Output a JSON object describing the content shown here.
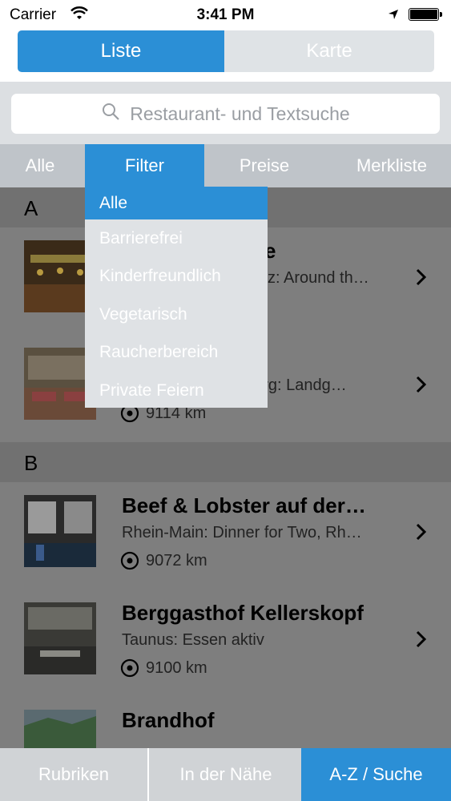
{
  "status_bar": {
    "carrier": "Carrier",
    "time": "3:41 PM"
  },
  "segment": {
    "list_label": "Liste",
    "map_label": "Karte"
  },
  "search": {
    "placeholder": "Restaurant- und Textsuche"
  },
  "filter_tabs": [
    {
      "label": "Alle"
    },
    {
      "label": "Filter"
    },
    {
      "label": "Preise"
    },
    {
      "label": "Merkliste"
    }
  ],
  "filter_dropdown": {
    "items": [
      {
        "label": "Alle"
      },
      {
        "label": "Barrierefrei"
      },
      {
        "label": "Kinderfreundlich"
      },
      {
        "label": "Vegetarisch"
      },
      {
        "label": "Raucherbereich"
      },
      {
        "label": "Private Feiern"
      }
    ]
  },
  "sections": [
    {
      "letter": "A",
      "rows": [
        {
          "title": "e",
          "subtitle": "z: Around th…",
          "distance": ""
        },
        {
          "title": "",
          "subtitle": "berg: Landg…",
          "distance": "9114 km"
        }
      ]
    },
    {
      "letter": "B",
      "rows": [
        {
          "title": "Beef & Lobster auf der…",
          "subtitle": "Rhein-Main: Dinner for Two, Rh…",
          "distance": "9072 km"
        },
        {
          "title": "Berggasthof Kellerskopf",
          "subtitle": "Taunus: Essen aktiv",
          "distance": "9100 km"
        },
        {
          "title": "Brandhof",
          "subtitle": "",
          "distance": ""
        }
      ]
    }
  ],
  "bottom_tabs": [
    {
      "label": "Rubriken"
    },
    {
      "label": "In der Nähe"
    },
    {
      "label": "A-Z / Suche"
    }
  ],
  "colors": {
    "accent": "#2b8fd6",
    "list_overlay": "#7e7e7e",
    "section_header": "#717171"
  }
}
